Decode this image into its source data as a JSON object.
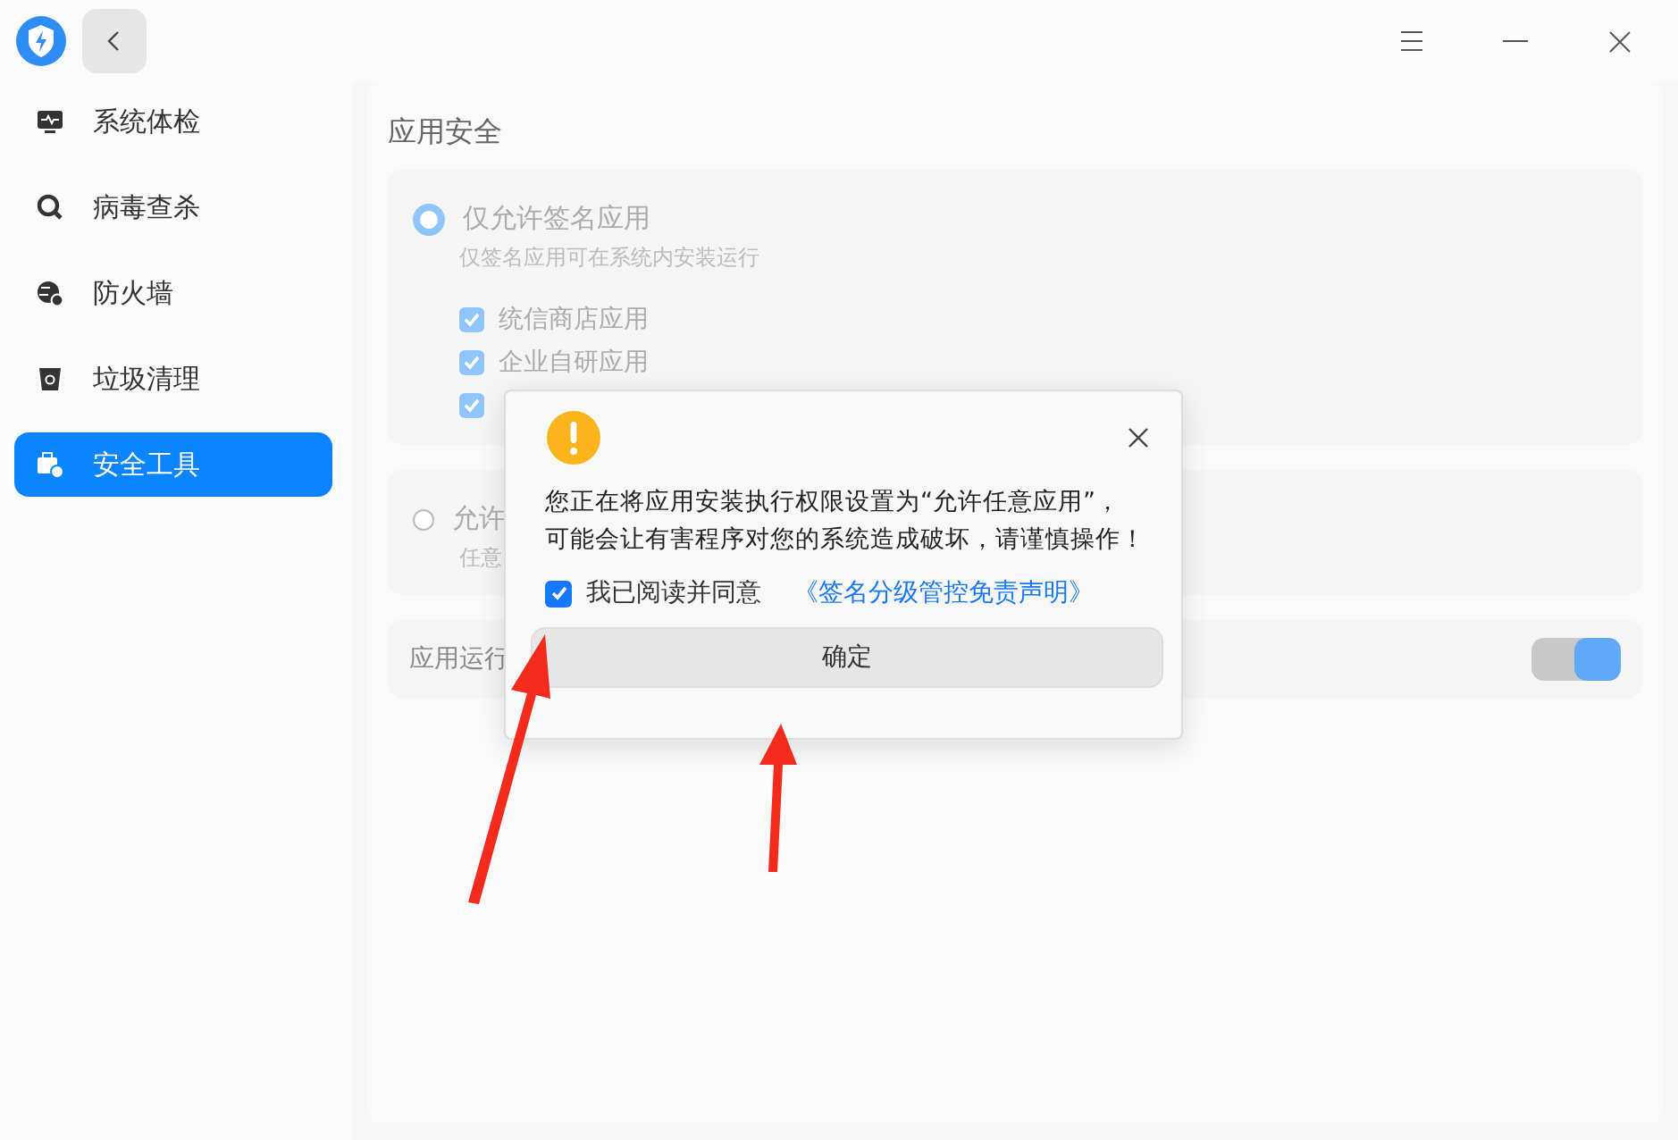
{
  "sidebar": {
    "items": [
      {
        "label": "系统体检",
        "kind": "monitor",
        "selected": false
      },
      {
        "label": "病毒查杀",
        "kind": "scan",
        "selected": false
      },
      {
        "label": "防火墙",
        "kind": "globe",
        "selected": false
      },
      {
        "label": "垃圾清理",
        "kind": "trash",
        "selected": false
      },
      {
        "label": "安全工具",
        "kind": "tools",
        "selected": true
      }
    ]
  },
  "section_title": "应用安全",
  "options": [
    {
      "label": "仅允许签名应用",
      "description": "仅签名应用可在系统内安装运行",
      "selected": true,
      "checks": [
        {
          "label": "统信商店应用",
          "checked": true
        },
        {
          "label": "企业自研应用",
          "checked": true
        },
        {
          "checked": true
        }
      ]
    },
    {
      "label": "允许",
      "description": "任意",
      "selected": false
    }
  ],
  "run_row": {
    "label": "应用运行",
    "on": true
  },
  "dialog": {
    "message": [
      "您正在将应用安装执行权限设置为“允许任意应用”，",
      "可能会让有害程序对您的系统造成破坏，请谨慎操作！"
    ],
    "agree": {
      "label": "我已阅读并同意",
      "checked": true
    },
    "link": "《签名分级管控免责声明》",
    "button": "确定"
  }
}
